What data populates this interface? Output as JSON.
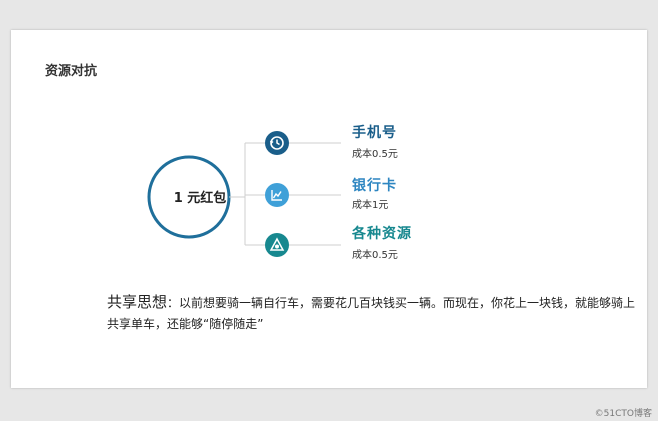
{
  "slide": {
    "title": "资源对抗",
    "center_label": "1 元红包",
    "items": [
      {
        "name": "手机号",
        "cost": "成本0.5元",
        "color": "#1a5e8a",
        "icon": "history-clock-icon"
      },
      {
        "name": "银行卡",
        "cost": "成本1元",
        "color": "#2e86c1",
        "icon": "chart-icon"
      },
      {
        "name": "各种资源",
        "cost": "成本0.5元",
        "color": "#17888f",
        "icon": "triangle-icon"
      }
    ],
    "share_head": "共享思想",
    "share_text": "：以前想要骑一辆自行车，需要花几百块钱买一辆。而现在，你花上一块钱，就能够骑上共享单车，还能够“随停随走”"
  },
  "watermark": "©51CTO博客",
  "colors": {
    "circle": "#1f6f9b",
    "line": "#cfcfcf"
  }
}
